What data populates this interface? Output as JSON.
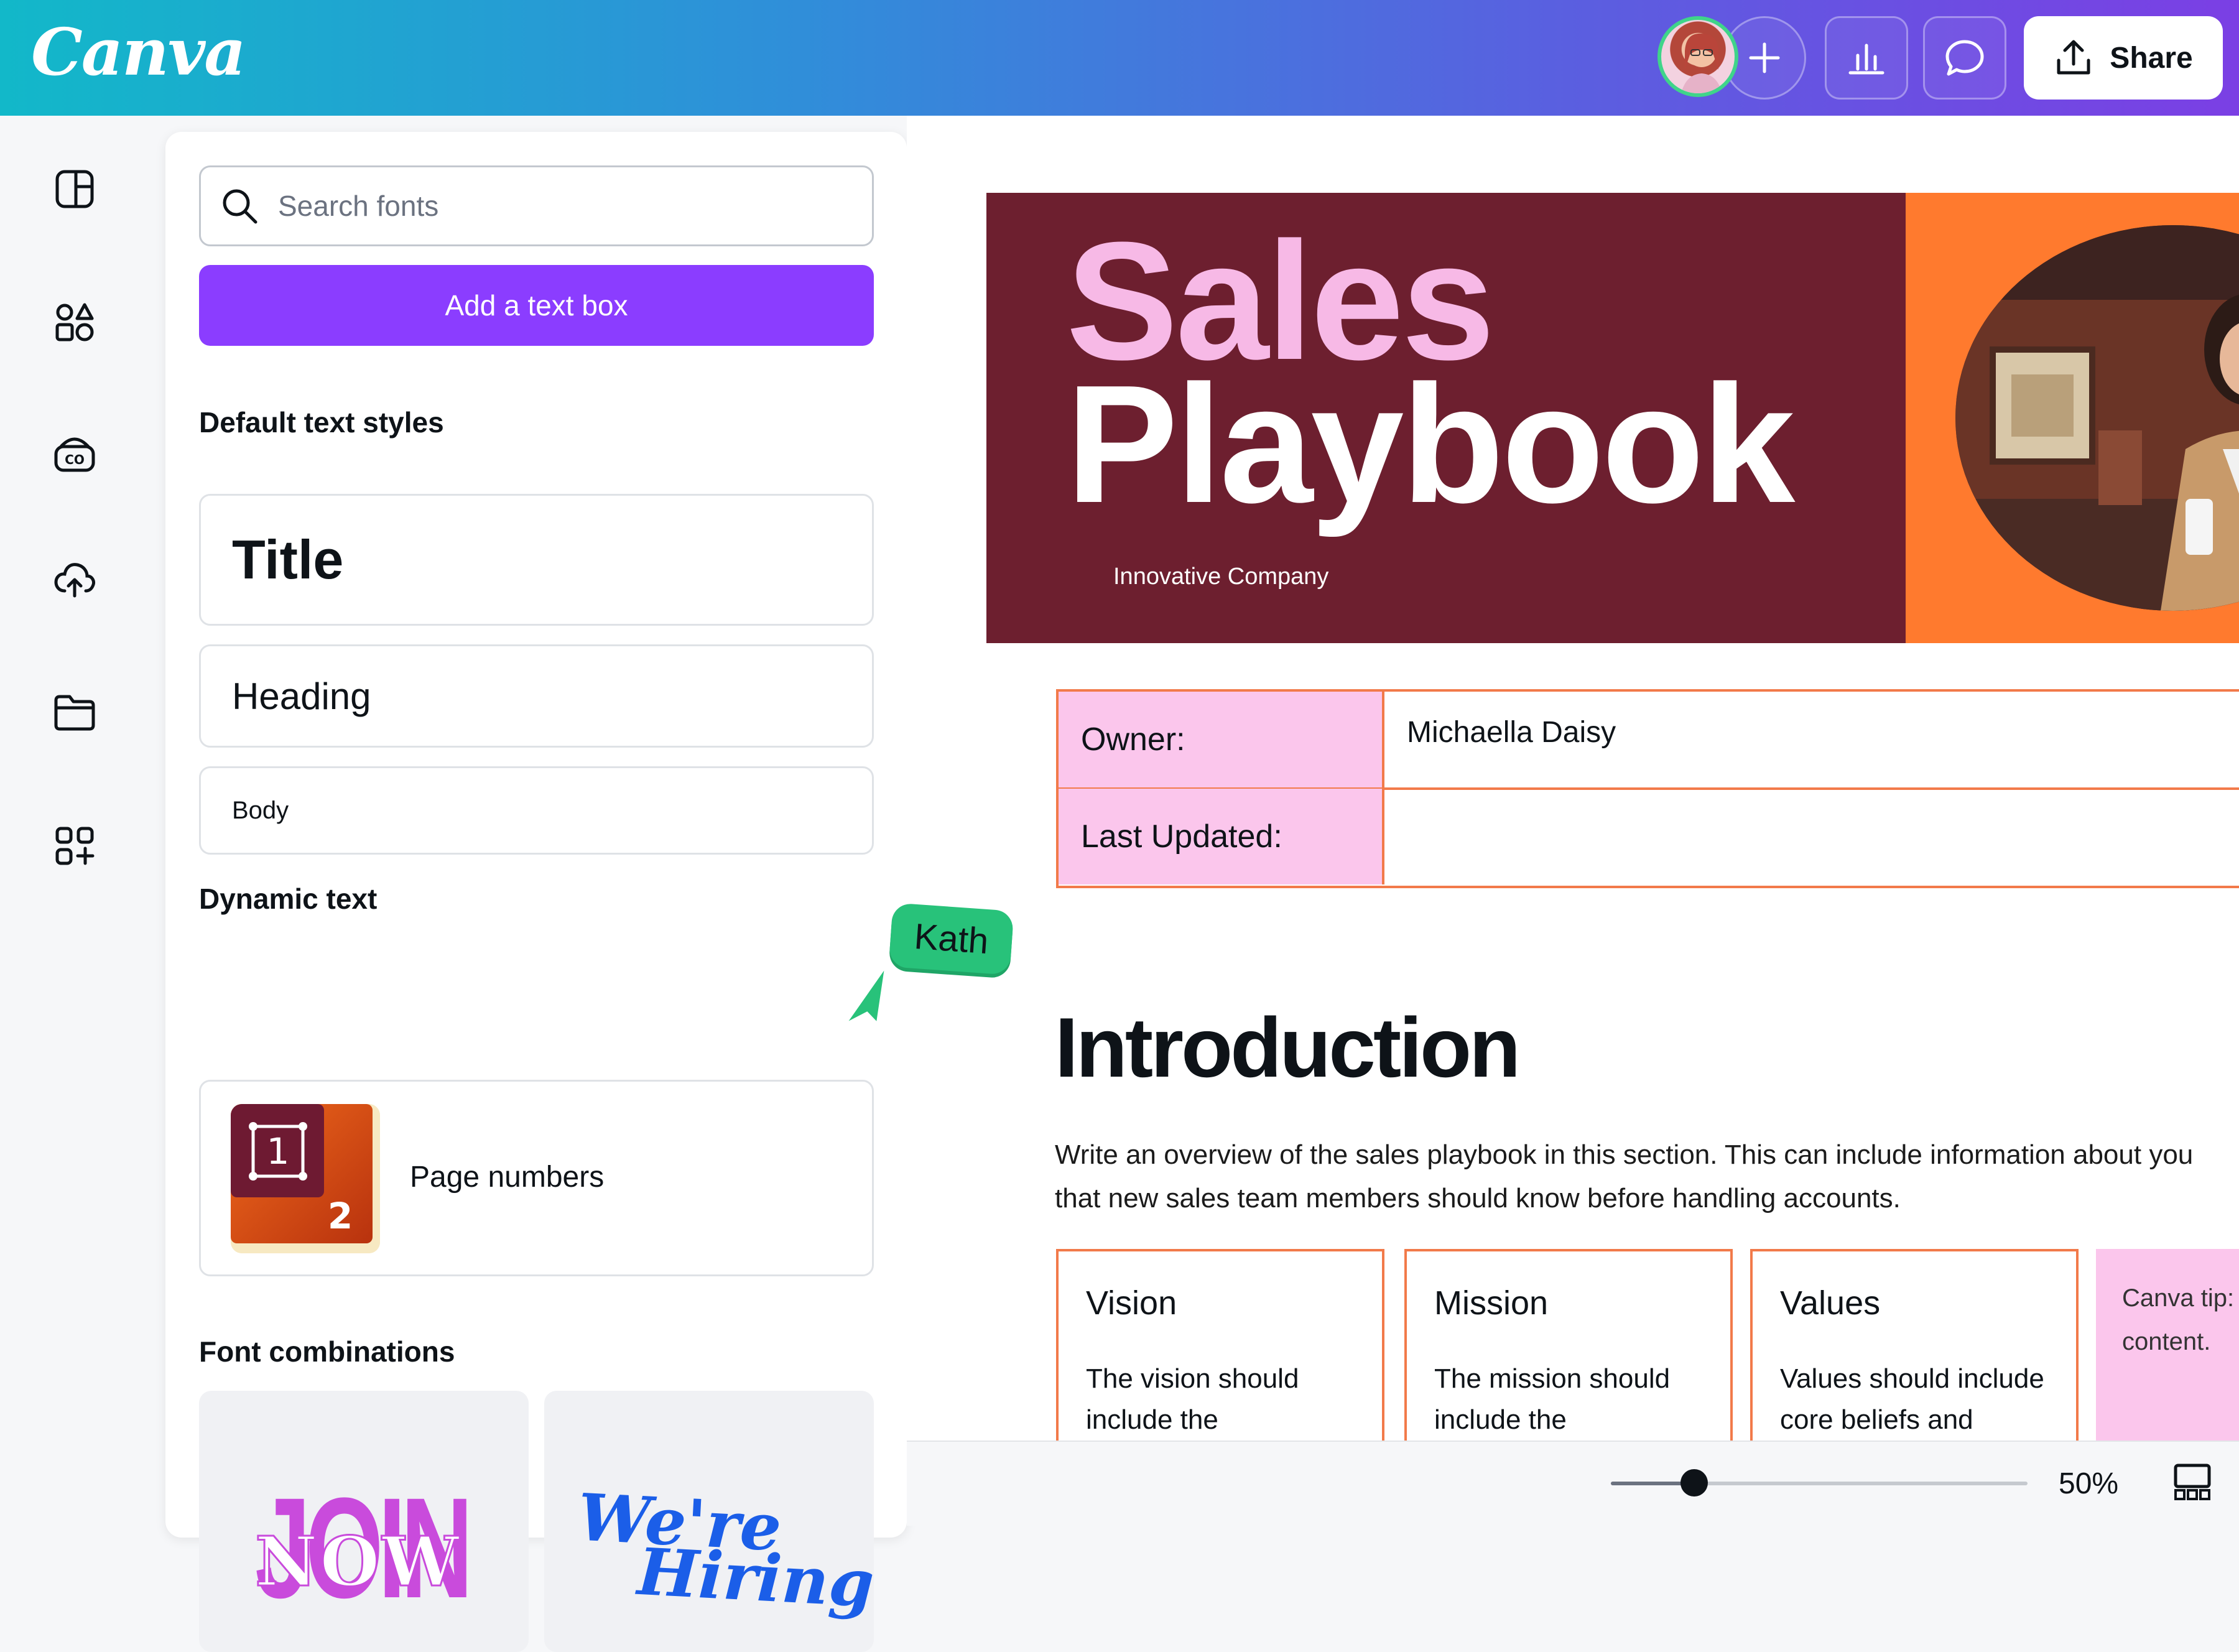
{
  "app": {
    "logo_text": "Canva",
    "brand_color": "#8b3dff",
    "accent_gradient": [
      "#12b8c9",
      "#7b3fe4"
    ]
  },
  "topbar": {
    "avatar_icon": "user-avatar",
    "add_icon": "plus-icon",
    "insights_icon": "bar-chart-icon",
    "comment_icon": "comment-icon",
    "share_icon": "upload-icon",
    "share_label": "Share"
  },
  "rail": {
    "items": [
      {
        "icon": "design-icon"
      },
      {
        "icon": "elements-icon"
      },
      {
        "icon": "brand-icon"
      },
      {
        "icon": "uploads-icon"
      },
      {
        "icon": "projects-icon"
      },
      {
        "icon": "apps-icon"
      }
    ]
  },
  "panel": {
    "search_placeholder": "Search fonts",
    "add_text_label": "Add a text box",
    "default_styles_heading": "Default text styles",
    "styles": {
      "title": "Title",
      "heading": "Heading",
      "body": "Body"
    },
    "dynamic_heading": "Dynamic text",
    "page_numbers": {
      "label": "Page numbers",
      "digit_1": "1",
      "digit_2": "2"
    },
    "font_combinations_heading": "Font combinations",
    "combos": [
      {
        "line1": "JOIN",
        "line2": "NOW"
      },
      {
        "line1": "We're",
        "line2": "Hiring!"
      }
    ]
  },
  "collaborator": {
    "name": "Kath",
    "color": "#28c27a"
  },
  "document": {
    "banner": {
      "title_line1": "Sales",
      "title_line2": "Playbook",
      "company": "Innovative Company",
      "left_color": "#6d1f2f",
      "right_color": "#ff7a2e",
      "title_line1_color": "#f7b9e6"
    },
    "info": {
      "owner_label": "Owner:",
      "owner_value": "Michaella Daisy",
      "updated_label": "Last Updated:",
      "updated_value": ""
    },
    "intro_heading": "Introduction",
    "intro_line1": "Write an overview of the sales playbook in this section. This can include information about you",
    "intro_line2": "that new sales team members should know before handling accounts.",
    "boxes": [
      {
        "title": "Vision",
        "body": "The vision should include the"
      },
      {
        "title": "Mission",
        "body": "The mission should include the"
      },
      {
        "title": "Values",
        "body": "Values should include core beliefs and"
      }
    ],
    "tip_text": "Canva tip: great for t content."
  },
  "zoom": {
    "value_label": "50%",
    "level": 0.2
  },
  "view_icon": "grid-view-icon"
}
